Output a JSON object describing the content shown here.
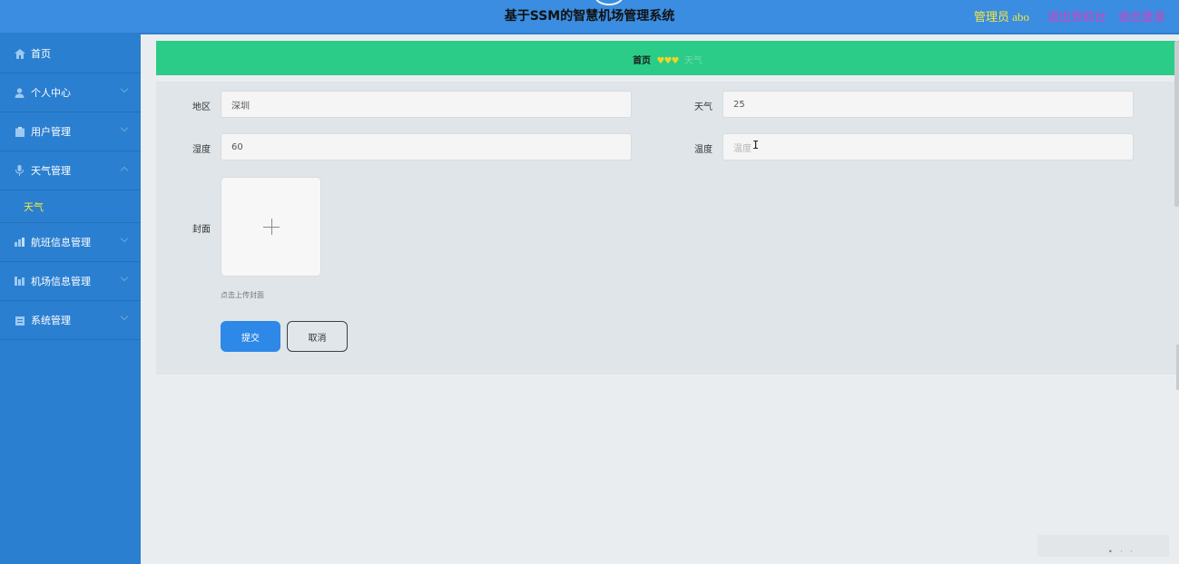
{
  "header": {
    "title": "基于SSM的智慧机场管理系统",
    "admin_label": "管理员 abo",
    "front_link": "退出到前台",
    "logout_link": "退出登录"
  },
  "sidebar": {
    "items": [
      {
        "label": "首页",
        "icon": "home-icon"
      },
      {
        "label": "个人中心",
        "icon": "user-icon"
      },
      {
        "label": "用户管理",
        "icon": "clipboard-icon"
      },
      {
        "label": "天气管理",
        "icon": "microphone-icon"
      },
      {
        "label": "航班信息管理",
        "icon": "chart-icon"
      },
      {
        "label": "机场信息管理",
        "icon": "bar-chart-icon"
      },
      {
        "label": "系统管理",
        "icon": "document-icon"
      }
    ],
    "active_sub_item": "天气"
  },
  "breadcrumb": {
    "home": "首页",
    "separator": "♥♥♥",
    "current": "天气"
  },
  "form": {
    "region_label": "地区",
    "region_value": "深圳",
    "weather_label": "天气",
    "weather_value": "25",
    "humidity_label": "湿度",
    "humidity_value": "60",
    "temperature_label": "温度",
    "temperature_placeholder": "温度",
    "cover_label": "封面",
    "cover_hint": "点击上传封面",
    "submit_label": "提交",
    "cancel_label": "取消"
  },
  "colors": {
    "header_bg": "#3a8de0",
    "sidebar_bg": "#2a7fd0",
    "breadcrumb_bg": "#2bcc88",
    "accent_yellow": "#f5e63c",
    "link_magenta": "#d63fc0",
    "submit_bg": "#2d88e8"
  }
}
